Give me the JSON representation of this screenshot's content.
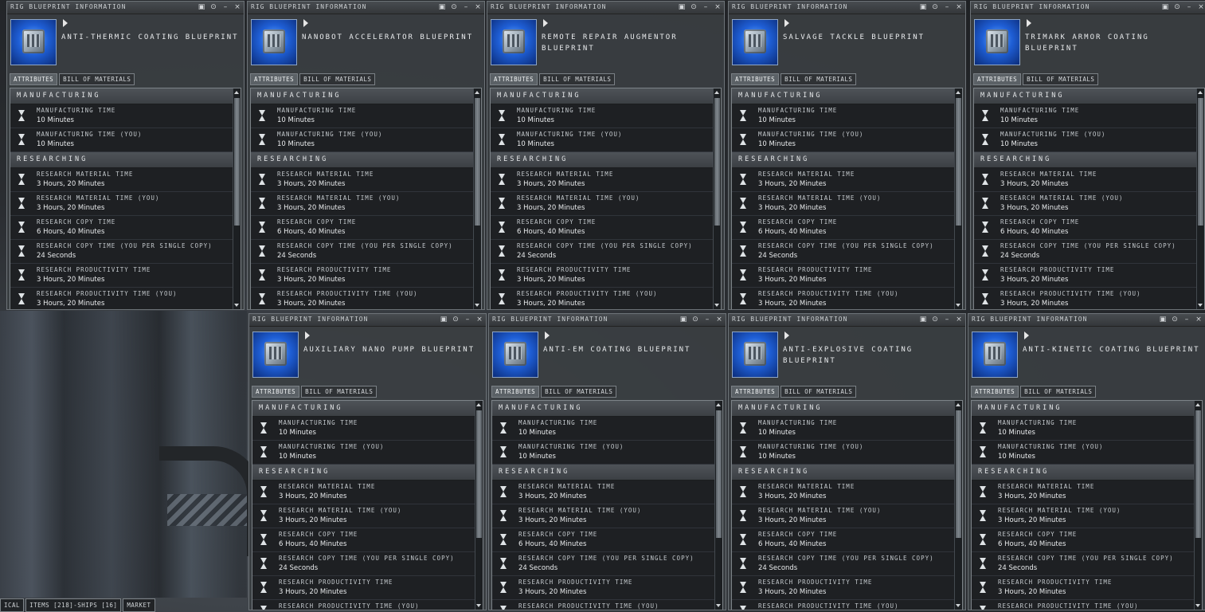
{
  "window_title": "RIG BLUEPRINT INFORMATION",
  "window_buttons": [
    "▣",
    "⊙",
    "–",
    "×"
  ],
  "tabs": [
    "ATTRIBUTES",
    "BILL OF MATERIALS"
  ],
  "sections": {
    "manufacturing": "MANUFACTURING",
    "researching": "RESEARCHING"
  },
  "rows": {
    "manufacturing": [
      {
        "label": "MANUFACTURING TIME",
        "value": "10 Minutes"
      },
      {
        "label": "MANUFACTURING TIME (YOU)",
        "value": "10 Minutes"
      }
    ],
    "researching": [
      {
        "label": "RESEARCH MATERIAL TIME",
        "value": "3 Hours, 20 Minutes"
      },
      {
        "label": "RESEARCH MATERIAL TIME (YOU)",
        "value": "3 Hours, 20 Minutes"
      },
      {
        "label": "RESEARCH COPY TIME",
        "value": "6 Hours, 40 Minutes"
      },
      {
        "label": "RESEARCH COPY TIME (YOU PER SINGLE COPY)",
        "value": "24 Seconds"
      },
      {
        "label": "RESEARCH PRODUCTIVITY TIME",
        "value": "3 Hours, 20 Minutes"
      },
      {
        "label": "RESEARCH PRODUCTIVITY TIME (YOU)",
        "value": "3 Hours, 20 Minutes"
      }
    ]
  },
  "windows": [
    {
      "name": "ANTI-THERMIC COATING BLUEPRINT"
    },
    {
      "name": "NANOBOT ACCELERATOR BLUEPRINT"
    },
    {
      "name": "REMOTE REPAIR AUGMENTOR BLUEPRINT"
    },
    {
      "name": "SALVAGE TACKLE BLUEPRINT"
    },
    {
      "name": "TRIMARK ARMOR COATING BLUEPRINT"
    },
    {
      "name": "AUXILIARY NANO PUMP BLUEPRINT"
    },
    {
      "name": "ANTI-EM COATING BLUEPRINT"
    },
    {
      "name": "ANTI-EXPLOSIVE COATING BLUEPRINT"
    },
    {
      "name": "ANTI-KINETIC COATING BLUEPRINT"
    }
  ],
  "taskbar": [
    "ICAL",
    "ITEMS [218]-SHIPS [16]",
    "MARKET"
  ]
}
